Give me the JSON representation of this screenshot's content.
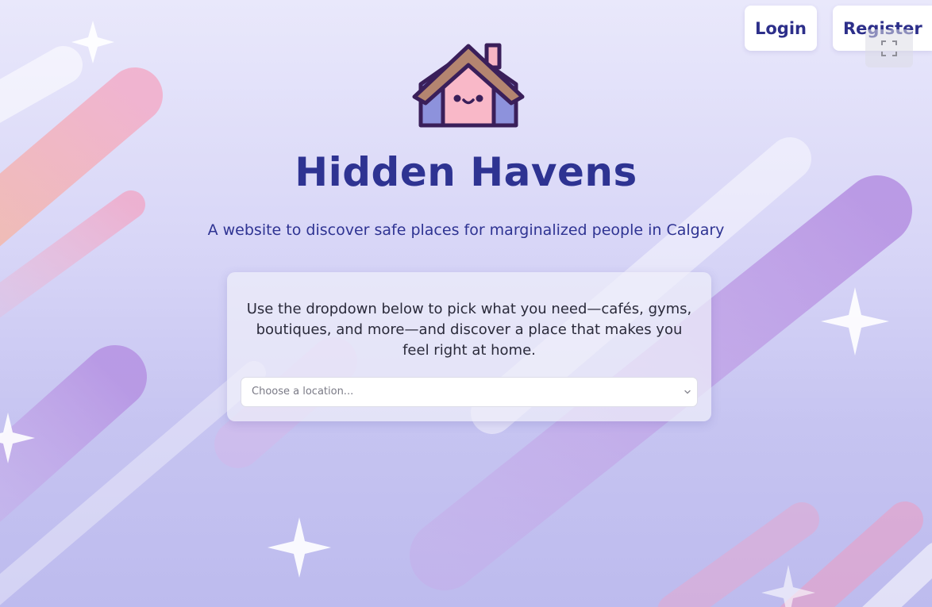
{
  "nav": {
    "login_label": "Login",
    "register_label": "Register"
  },
  "hero": {
    "logo_icon": "house-face-icon",
    "title": "Hidden Havens",
    "subtitle": "A website to discover safe places for marginalized people in Calgary"
  },
  "card": {
    "description": "Use the dropdown below to pick what you need—cafés, gyms, boutiques, and more—and discover a place that makes you feel right at home.",
    "select": {
      "placeholder": "Choose a location...",
      "icon": "chevron-down-icon"
    }
  },
  "overlay": {
    "expand_icon": "expand-icon"
  },
  "colors": {
    "title": "#2e3392",
    "background_top": "#e9e8fb",
    "background_bottom": "#bdbbee",
    "card": "#eeeefa"
  }
}
